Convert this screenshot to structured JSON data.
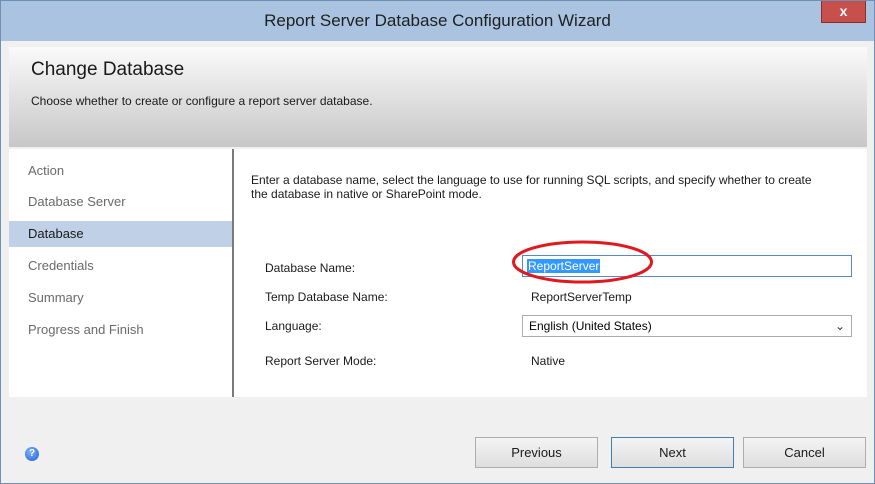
{
  "window": {
    "title": "Report Server Database Configuration Wizard",
    "close_glyph": "x"
  },
  "header": {
    "title": "Change Database",
    "subtitle": "Choose whether to create or configure a report server database."
  },
  "nav": {
    "items": [
      {
        "label": "Action"
      },
      {
        "label": "Database Server"
      },
      {
        "label": "Database",
        "selected": true
      },
      {
        "label": "Credentials"
      },
      {
        "label": "Summary"
      },
      {
        "label": "Progress and Finish"
      }
    ]
  },
  "content": {
    "intro": "Enter a database name, select the language to use for running SQL scripts, and specify whether to create the database in native or SharePoint mode.",
    "fields": {
      "db_name_label": "Database Name:",
      "db_name_value": "ReportServer",
      "temp_db_label": "Temp Database Name:",
      "temp_db_value": "ReportServerTemp",
      "language_label": "Language:",
      "language_value": "English (United States)",
      "mode_label": "Report Server Mode:",
      "mode_value": "Native"
    }
  },
  "footer": {
    "help_glyph": "?",
    "previous_label": "Previous",
    "next_label": "Next",
    "cancel_label": "Cancel"
  },
  "colors": {
    "titlebar": "#a9c3e0",
    "close_button": "#c7504c",
    "nav_selected": "#bfd0e7",
    "annotation_ellipse": "#e0191e",
    "input_border": "#5b87c8"
  },
  "icons": {
    "help": "help-icon",
    "dropdown": "chevron-down-icon",
    "close": "close-icon"
  }
}
